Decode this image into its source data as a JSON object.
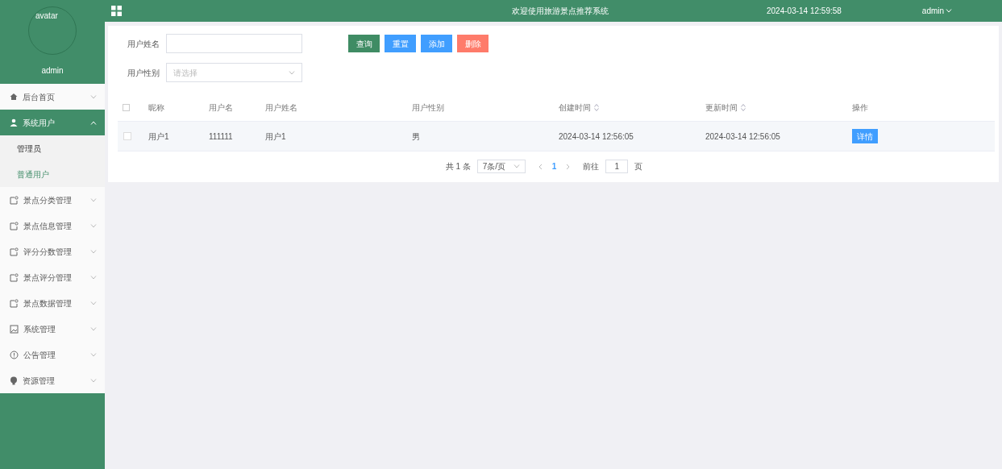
{
  "sidebar": {
    "avatar_label": "avatar",
    "username": "admin",
    "items": [
      {
        "label": "后台首页",
        "selected": false,
        "expanded": false
      },
      {
        "label": "系统用户",
        "selected": true,
        "expanded": true,
        "children": [
          {
            "label": "管理员",
            "selected": false
          },
          {
            "label": "普通用户",
            "selected": true
          }
        ]
      },
      {
        "label": "景点分类管理",
        "selected": false,
        "expanded": false
      },
      {
        "label": "景点信息管理",
        "selected": false,
        "expanded": false
      },
      {
        "label": "评分分数管理",
        "selected": false,
        "expanded": false
      },
      {
        "label": "景点评分管理",
        "selected": false,
        "expanded": false
      },
      {
        "label": "景点数据管理",
        "selected": false,
        "expanded": false
      },
      {
        "label": "系统管理",
        "selected": false,
        "expanded": false
      },
      {
        "label": "公告管理",
        "selected": false,
        "expanded": false
      },
      {
        "label": "资源管理",
        "selected": false,
        "expanded": false
      }
    ]
  },
  "header": {
    "title": "欢迎使用旅游景点推荐系统",
    "datetime": "2024-03-14 12:59:58",
    "user": "admin"
  },
  "filters": [
    {
      "label": "用户姓名",
      "kind": "text"
    },
    {
      "label": "用户性别",
      "kind": "select",
      "placeholder": "请选择"
    }
  ],
  "buttons": [
    {
      "label": "查询",
      "color": "#3f8c64"
    },
    {
      "label": "重置",
      "color": "#409eff"
    },
    {
      "label": "添加",
      "color": "#409eff"
    },
    {
      "label": "删除",
      "color": "#fe7b6a"
    }
  ],
  "table": {
    "all_checked": false,
    "columns": [
      {
        "label": "昵称",
        "sortable": false
      },
      {
        "label": "用户名",
        "sortable": false
      },
      {
        "label": "用户姓名",
        "sortable": false
      },
      {
        "label": "用户性别",
        "sortable": false
      },
      {
        "label": "创建时间",
        "sortable": true
      },
      {
        "label": "更新时间",
        "sortable": true
      },
      {
        "label": "操作",
        "sortable": false
      }
    ],
    "rows": [
      {
        "checked": false,
        "cells": [
          "用户1",
          "111111",
          "用户1",
          "男",
          "2024-03-14 12:56:05",
          "2024-03-14 12:56:05"
        ],
        "action": "详情"
      }
    ]
  },
  "pagination": {
    "total": "共 1 条",
    "page_size": "7条/页",
    "pages": [
      {
        "label": "1",
        "selected": true
      }
    ],
    "goto_label": "前往",
    "goto_value": "1",
    "page_suffix": "页"
  }
}
